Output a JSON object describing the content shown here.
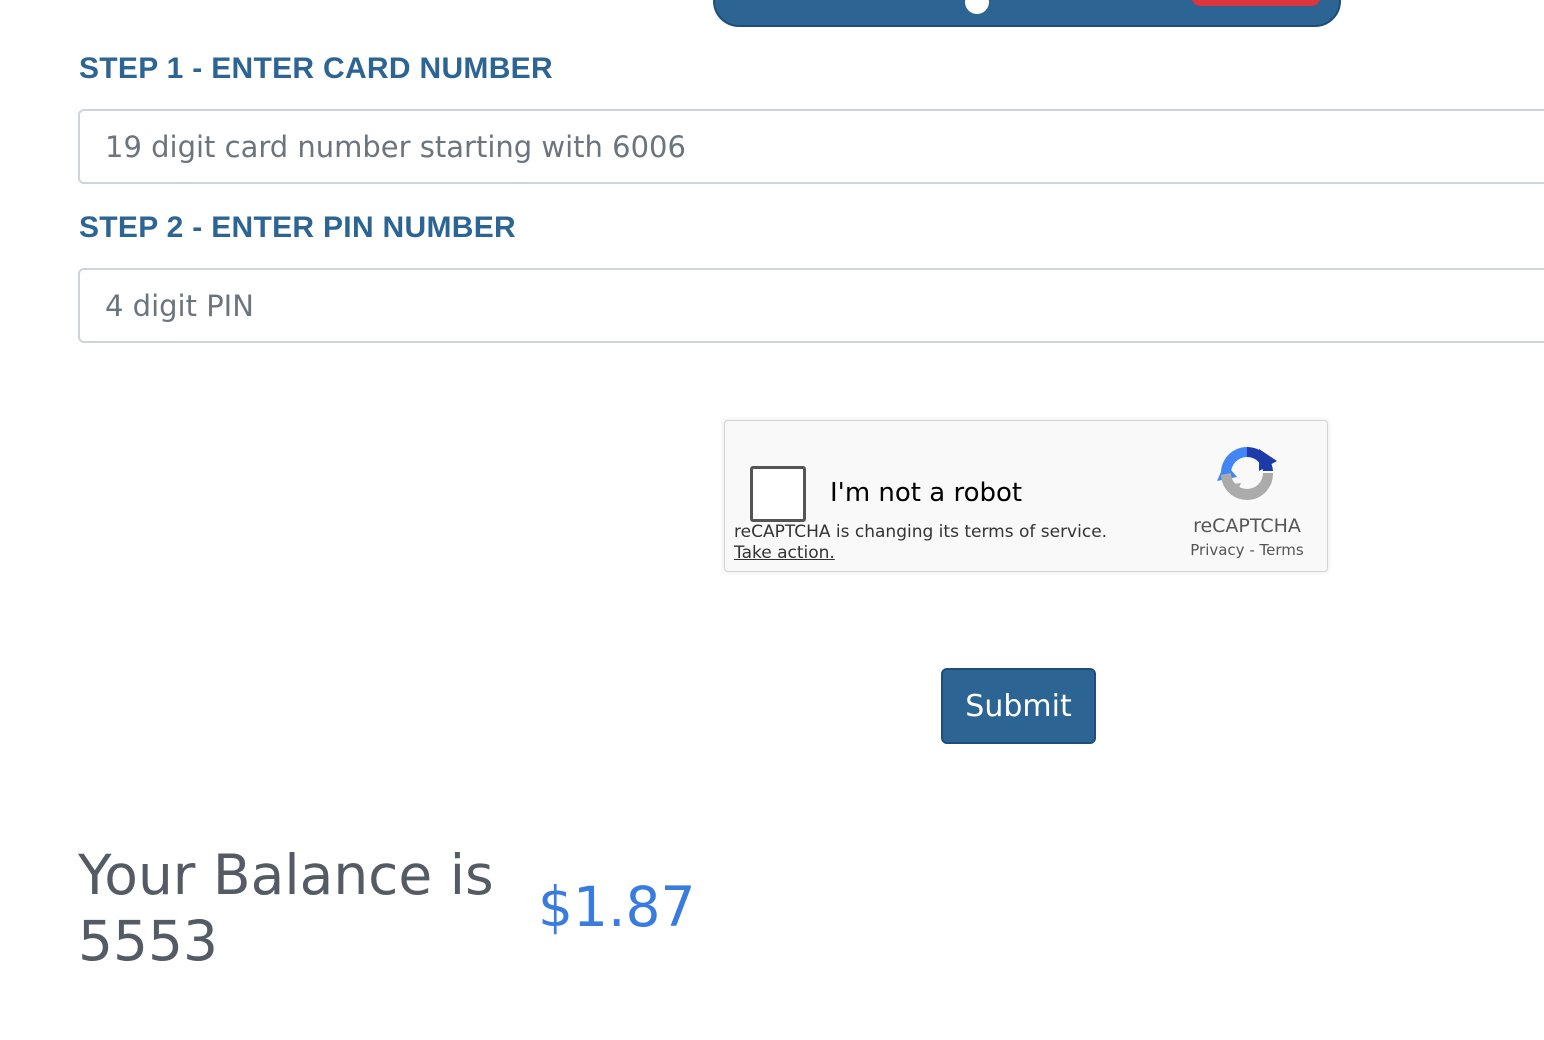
{
  "form": {
    "step1": {
      "label": "STEP 1 - ENTER CARD NUMBER",
      "placeholder": "19 digit card number starting with 6006",
      "value": ""
    },
    "step2": {
      "label": "STEP 2 - ENTER PIN NUMBER",
      "placeholder": "4 digit PIN",
      "value": ""
    },
    "submit_label": "Submit"
  },
  "recaptcha": {
    "checkbox_label": "I'm not a robot",
    "notice": "reCAPTCHA is changing its terms of service.",
    "take_action": "Take action.",
    "brand": "reCAPTCHA",
    "privacy": "Privacy",
    "separator": "-",
    "terms": "Terms",
    "checked": false
  },
  "result": {
    "label": "Your Balance is 5553",
    "amount": "$1.87"
  },
  "colors": {
    "primary": "#2c6493",
    "accent_red": "#d9363e",
    "amount": "#3a7be0",
    "balance_text": "#545b64"
  }
}
